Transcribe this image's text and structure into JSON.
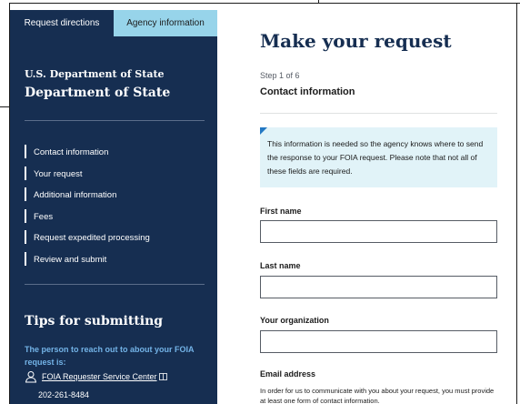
{
  "sidebar": {
    "tabs": [
      {
        "label": "Request directions",
        "active": false
      },
      {
        "label": "Agency information",
        "active": true
      }
    ],
    "agency_parent": "U.S. Department of State",
    "agency_name": "Department of State",
    "steps": [
      "Contact information",
      "Your request",
      "Additional information",
      "Fees",
      "Request expedited processing",
      "Review and submit"
    ],
    "tips_title": "Tips for submitting",
    "tips_note": "The person to reach out to about your FOIA request is:",
    "service_center_link": "FOIA Requester Service Center",
    "phone": "202-261-8484"
  },
  "main": {
    "title": "Make your request",
    "step_count": "Step 1 of 6",
    "section_title": "Contact information",
    "info_text": "This information is needed so the agency knows where to send the response to your FOIA request. Please note that not all of these fields are required.",
    "fields": {
      "first_name": {
        "label": "First name",
        "value": ""
      },
      "last_name": {
        "label": "Last name",
        "value": ""
      },
      "organization": {
        "label": "Your organization",
        "value": ""
      },
      "email": {
        "label": "Email address",
        "help": "In order for us to communicate with you about your request, you must provide at least one form of contact information."
      }
    }
  },
  "colors": {
    "sidebar_bg": "#162e51",
    "active_tab": "#97d4ea",
    "info_bg": "#e1f3f8",
    "accent": "#2378c3",
    "tips_note": "#73b3e7"
  }
}
